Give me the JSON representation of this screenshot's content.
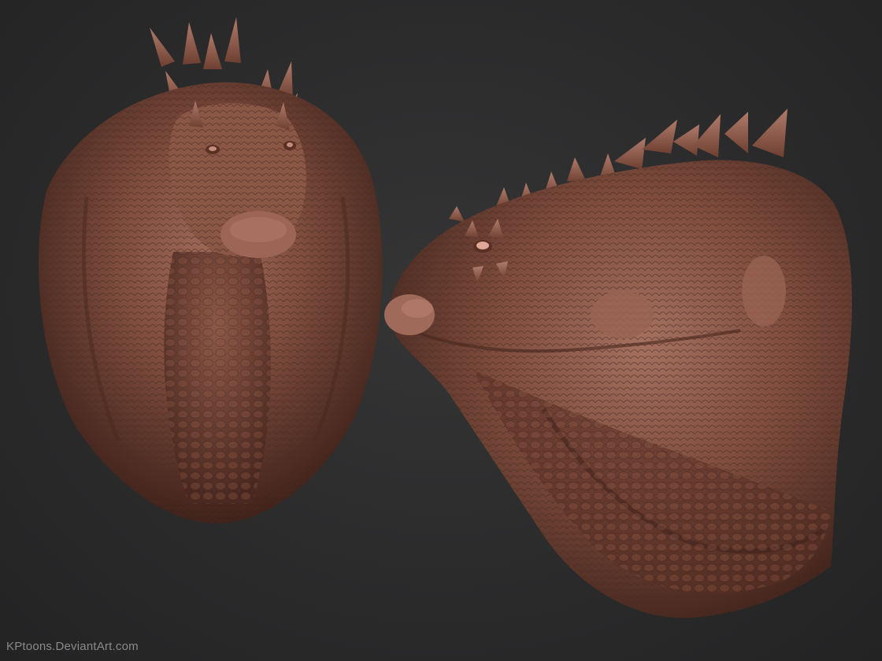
{
  "watermark": {
    "text": "KPtoons.DeviantArt.com"
  },
  "colors": {
    "background": "#2b2b2c",
    "sculpt_base": "#7a4a3b",
    "sculpt_highlight": "#a87262",
    "sculpt_shadow": "#3e2119"
  },
  "figures": [
    {
      "name": "dragon-head-front-view"
    },
    {
      "name": "dragon-head-side-view"
    }
  ]
}
